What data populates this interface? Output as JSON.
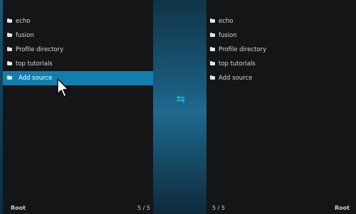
{
  "left_pane": {
    "items": [
      {
        "label": "echo"
      },
      {
        "label": "fusion"
      },
      {
        "label": "Profile directory"
      },
      {
        "label": "top tutorials"
      },
      {
        "label": "Add source"
      }
    ],
    "selected_index": 4,
    "path": "Root",
    "count": "5 / 5"
  },
  "right_pane": {
    "items": [
      {
        "label": "echo"
      },
      {
        "label": "fusion"
      },
      {
        "label": "Profile directory"
      },
      {
        "label": "top tutorials"
      },
      {
        "label": "Add source"
      }
    ],
    "path": "Root",
    "count": "5 / 5"
  },
  "center": {
    "icon": "swap-arrows-icon",
    "icon_color": "#29a9e1"
  },
  "colors": {
    "selection": "#117fae",
    "background": "#141517"
  }
}
